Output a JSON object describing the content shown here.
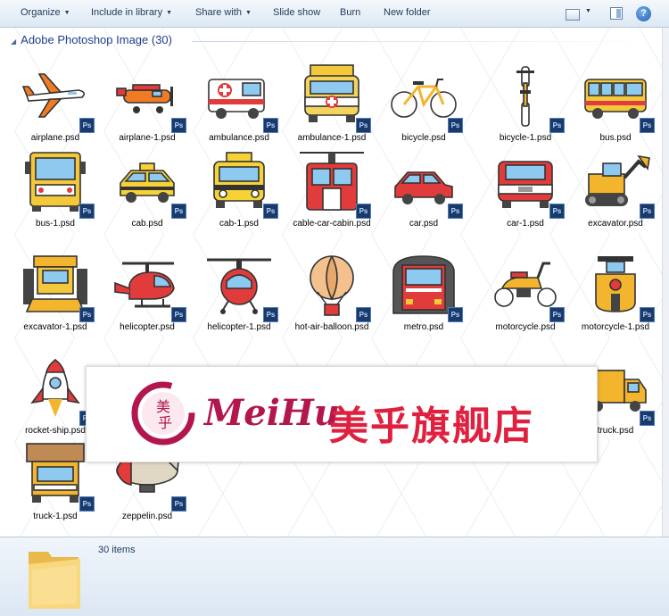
{
  "toolbar": {
    "organize": "Organize",
    "include_in_library": "Include in library",
    "share_with": "Share with",
    "slide_show": "Slide show",
    "burn": "Burn",
    "new_folder": "New folder"
  },
  "group": {
    "title": "Adobe Photoshop Image (30)"
  },
  "files": [
    {
      "name": "airplane.psd",
      "icon": "airplane"
    },
    {
      "name": "airplane-1.psd",
      "icon": "airplane-1"
    },
    {
      "name": "ambulance.psd",
      "icon": "ambulance"
    },
    {
      "name": "ambulance-1.psd",
      "icon": "ambulance-1"
    },
    {
      "name": "bicycle.psd",
      "icon": "bicycle"
    },
    {
      "name": "bicycle-1.psd",
      "icon": "bicycle-1"
    },
    {
      "name": "bus.psd",
      "icon": "bus"
    },
    {
      "name": "bus-1.psd",
      "icon": "bus-1"
    },
    {
      "name": "cab.psd",
      "icon": "cab"
    },
    {
      "name": "cab-1.psd",
      "icon": "cab-1"
    },
    {
      "name": "cable-car-cabin.psd",
      "icon": "cable-car"
    },
    {
      "name": "car.psd",
      "icon": "car"
    },
    {
      "name": "car-1.psd",
      "icon": "car-1"
    },
    {
      "name": "excavator.psd",
      "icon": "excavator"
    },
    {
      "name": "excavator-1.psd",
      "icon": "excavator-1"
    },
    {
      "name": "helicopter.psd",
      "icon": "helicopter"
    },
    {
      "name": "helicopter-1.psd",
      "icon": "helicopter-1"
    },
    {
      "name": "hot-air-balloon.psd",
      "icon": "balloon"
    },
    {
      "name": "metro.psd",
      "icon": "metro"
    },
    {
      "name": "motorcycle.psd",
      "icon": "motorcycle"
    },
    {
      "name": "motorcycle-1.psd",
      "icon": "motorcycle-1"
    },
    {
      "name": "rocket-ship.psd",
      "icon": "rocket"
    },
    {
      "name": "",
      "icon": "hidden"
    },
    {
      "name": "",
      "icon": "hidden"
    },
    {
      "name": "",
      "icon": "hidden"
    },
    {
      "name": "",
      "icon": "hidden"
    },
    {
      "name": "",
      "icon": "hidden"
    },
    {
      "name": "truck.psd",
      "icon": "truck"
    },
    {
      "name": "truck-1.psd",
      "icon": "truck-1"
    },
    {
      "name": "zeppelin.psd",
      "icon": "zeppelin"
    }
  ],
  "file_badge": "Ps",
  "banner": {
    "brand_latin": "MeiHu",
    "brand_cjk": "美乎旗舰店",
    "seal_text": "美乎"
  },
  "details": {
    "items_count": "30 items"
  },
  "colors": {
    "accent_red": "#e0203f",
    "brand_maroon": "#b3164e",
    "ps_navy": "#1b3a6a",
    "link_blue": "#1e3e8a"
  }
}
